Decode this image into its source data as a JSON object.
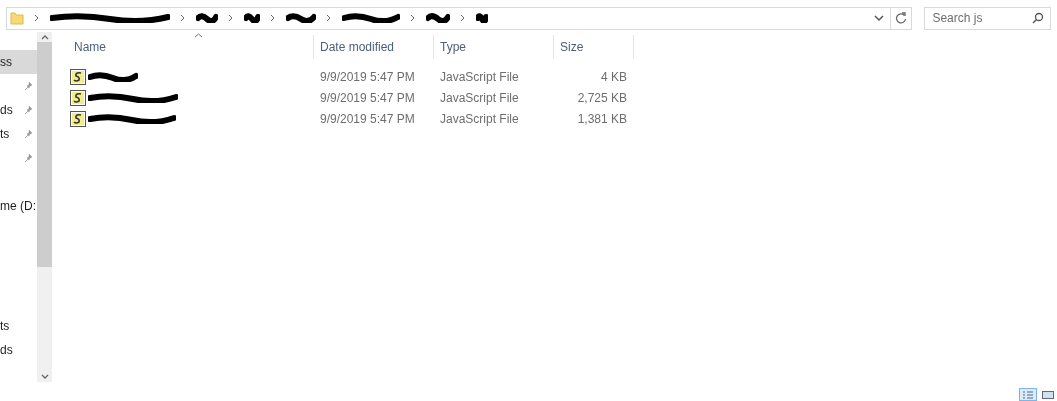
{
  "address_bar": {
    "segments": [
      {
        "kind": "redacted"
      },
      {
        "kind": "redacted"
      },
      {
        "kind": "redacted"
      },
      {
        "kind": "redacted"
      },
      {
        "kind": "redacted"
      },
      {
        "kind": "redacted"
      },
      {
        "kind": "redacted"
      }
    ]
  },
  "search": {
    "placeholder": "Search js"
  },
  "sidebar": {
    "groups": [
      {
        "items": [
          {
            "label": "ss",
            "pinned": false,
            "selected": true
          },
          {
            "pinned": true,
            "selected": false
          },
          {
            "label": "ds",
            "pinned": true,
            "selected": false
          },
          {
            "label": "ts",
            "pinned": true,
            "selected": false
          },
          {
            "pinned": true,
            "selected": false
          }
        ]
      },
      {
        "items": [
          {
            "label": "me (D:",
            "pinned": false,
            "selected": false
          }
        ]
      },
      {
        "items": [
          {
            "label": "ts",
            "pinned": false,
            "selected": false
          },
          {
            "label": "ds",
            "pinned": false,
            "selected": false
          }
        ]
      }
    ]
  },
  "table": {
    "columns": [
      "Name",
      "Date modified",
      "Type",
      "Size"
    ],
    "rows": [
      {
        "name": {
          "kind": "redacted"
        },
        "date": "9/9/2019 5:47 PM",
        "type": "JavaScript File",
        "size": "4 KB"
      },
      {
        "name": {
          "kind": "redacted"
        },
        "date": "9/9/2019 5:47 PM",
        "type": "JavaScript File",
        "size": "2,725 KB"
      },
      {
        "name": {
          "kind": "redacted"
        },
        "date": "9/9/2019 5:47 PM",
        "type": "JavaScript File",
        "size": "1,381 KB"
      }
    ]
  },
  "status_bar": {
    "views": [
      {
        "selected": true
      },
      {
        "selected": false
      }
    ]
  }
}
